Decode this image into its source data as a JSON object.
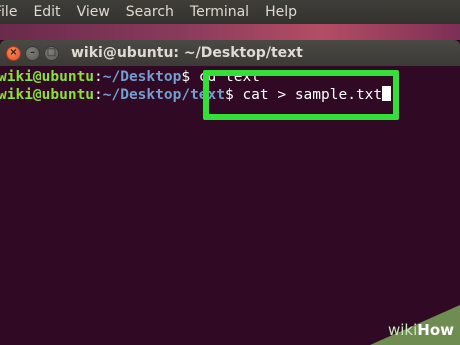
{
  "menubar": {
    "items": [
      "File",
      "Edit",
      "View",
      "Search",
      "Terminal",
      "Help"
    ]
  },
  "window": {
    "title": "wiki@ubuntu: ~/Desktop/text",
    "close_glyph": "×",
    "minimize_glyph": "–",
    "maximize_glyph": "□"
  },
  "terminal": {
    "lines": [
      {
        "user": "wiki@ubuntu",
        "colon": ":",
        "path": "~/Desktop",
        "dollar": "$ ",
        "command": "cd text"
      },
      {
        "user": "wiki@ubuntu",
        "colon": ":",
        "path": "~/Desktop/text",
        "dollar": "$ ",
        "command": "cat > sample.txt"
      }
    ]
  },
  "colors": {
    "terminal_bg": "#300a24",
    "user_green": "#8ae234",
    "path_blue": "#729fcf",
    "highlight_green": "#33e038"
  },
  "watermark": {
    "part1": "wiki",
    "part2": "How"
  }
}
